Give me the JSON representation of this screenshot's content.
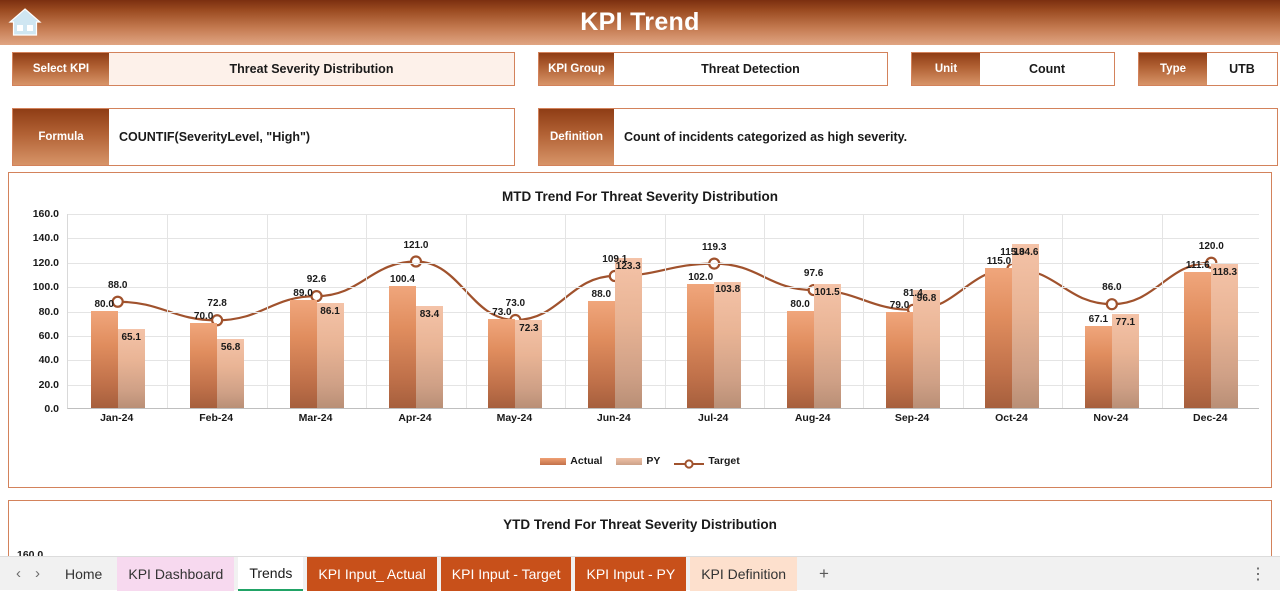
{
  "header": {
    "title": "KPI Trend",
    "home_icon": "home-icon"
  },
  "fields": {
    "select_kpi": {
      "label": "Select KPI",
      "value": "Threat Severity Distribution"
    },
    "kpi_group": {
      "label": "KPI Group",
      "value": "Threat Detection"
    },
    "unit": {
      "label": "Unit",
      "value": "Count"
    },
    "type": {
      "label": "Type",
      "value": "UTB"
    },
    "formula": {
      "label": "Formula",
      "value": "COUNTIF(SeverityLevel, \"High\")"
    },
    "definition": {
      "label": "Definition",
      "value": "Count of incidents categorized as high severity."
    }
  },
  "ytd_panel": {
    "title": "YTD Trend For Threat Severity Distribution",
    "first_tick": "160.0"
  },
  "tabbar": {
    "prev_icon": "chevron-left-icon",
    "next_icon": "chevron-right-icon",
    "add_label": "+",
    "kebab_label": "⋮",
    "tabs": [
      {
        "label": "Home",
        "style": "plain",
        "active": false
      },
      {
        "label": "KPI Dashboard",
        "style": "pink",
        "active": false
      },
      {
        "label": "Trends",
        "style": "active",
        "active": true
      },
      {
        "label": "KPI Input_ Actual",
        "style": "orange",
        "active": false
      },
      {
        "label": "KPI Input - Target",
        "style": "orange",
        "active": false
      },
      {
        "label": "KPI Input - PY",
        "style": "orange",
        "active": false
      },
      {
        "label": "KPI Definition",
        "style": "peach",
        "active": false
      }
    ]
  },
  "chart_data": {
    "type": "bar",
    "title": "MTD Trend For Threat Severity Distribution",
    "xlabel": "",
    "ylabel": "",
    "ylim": [
      0,
      160
    ],
    "yticks": [
      "0.0",
      "20.0",
      "40.0",
      "60.0",
      "80.0",
      "100.0",
      "120.0",
      "140.0",
      "160.0"
    ],
    "grid": true,
    "legend_position": "bottom",
    "categories": [
      "Jan-24",
      "Feb-24",
      "Mar-24",
      "Apr-24",
      "May-24",
      "Jun-24",
      "Jul-24",
      "Aug-24",
      "Sep-24",
      "Oct-24",
      "Nov-24",
      "Dec-24"
    ],
    "series": [
      {
        "name": "Actual",
        "type": "bar",
        "color": "#e08d5e",
        "values": [
          80.0,
          70.0,
          89.0,
          100.4,
          73.0,
          88.0,
          102.0,
          80.0,
          79.0,
          115.0,
          67.1,
          111.6
        ]
      },
      {
        "name": "PY",
        "type": "bar",
        "color": "#e9b495",
        "values": [
          65.1,
          56.8,
          86.1,
          83.4,
          72.3,
          123.3,
          103.8,
          101.5,
          96.8,
          134.6,
          77.1,
          118.3
        ]
      },
      {
        "name": "Target",
        "type": "line",
        "color": "#a0522d",
        "values": [
          88.0,
          72.8,
          92.6,
          121.0,
          73.0,
          109.1,
          119.3,
          97.6,
          81.4,
          115.0,
          86.0,
          120.0
        ]
      }
    ]
  }
}
